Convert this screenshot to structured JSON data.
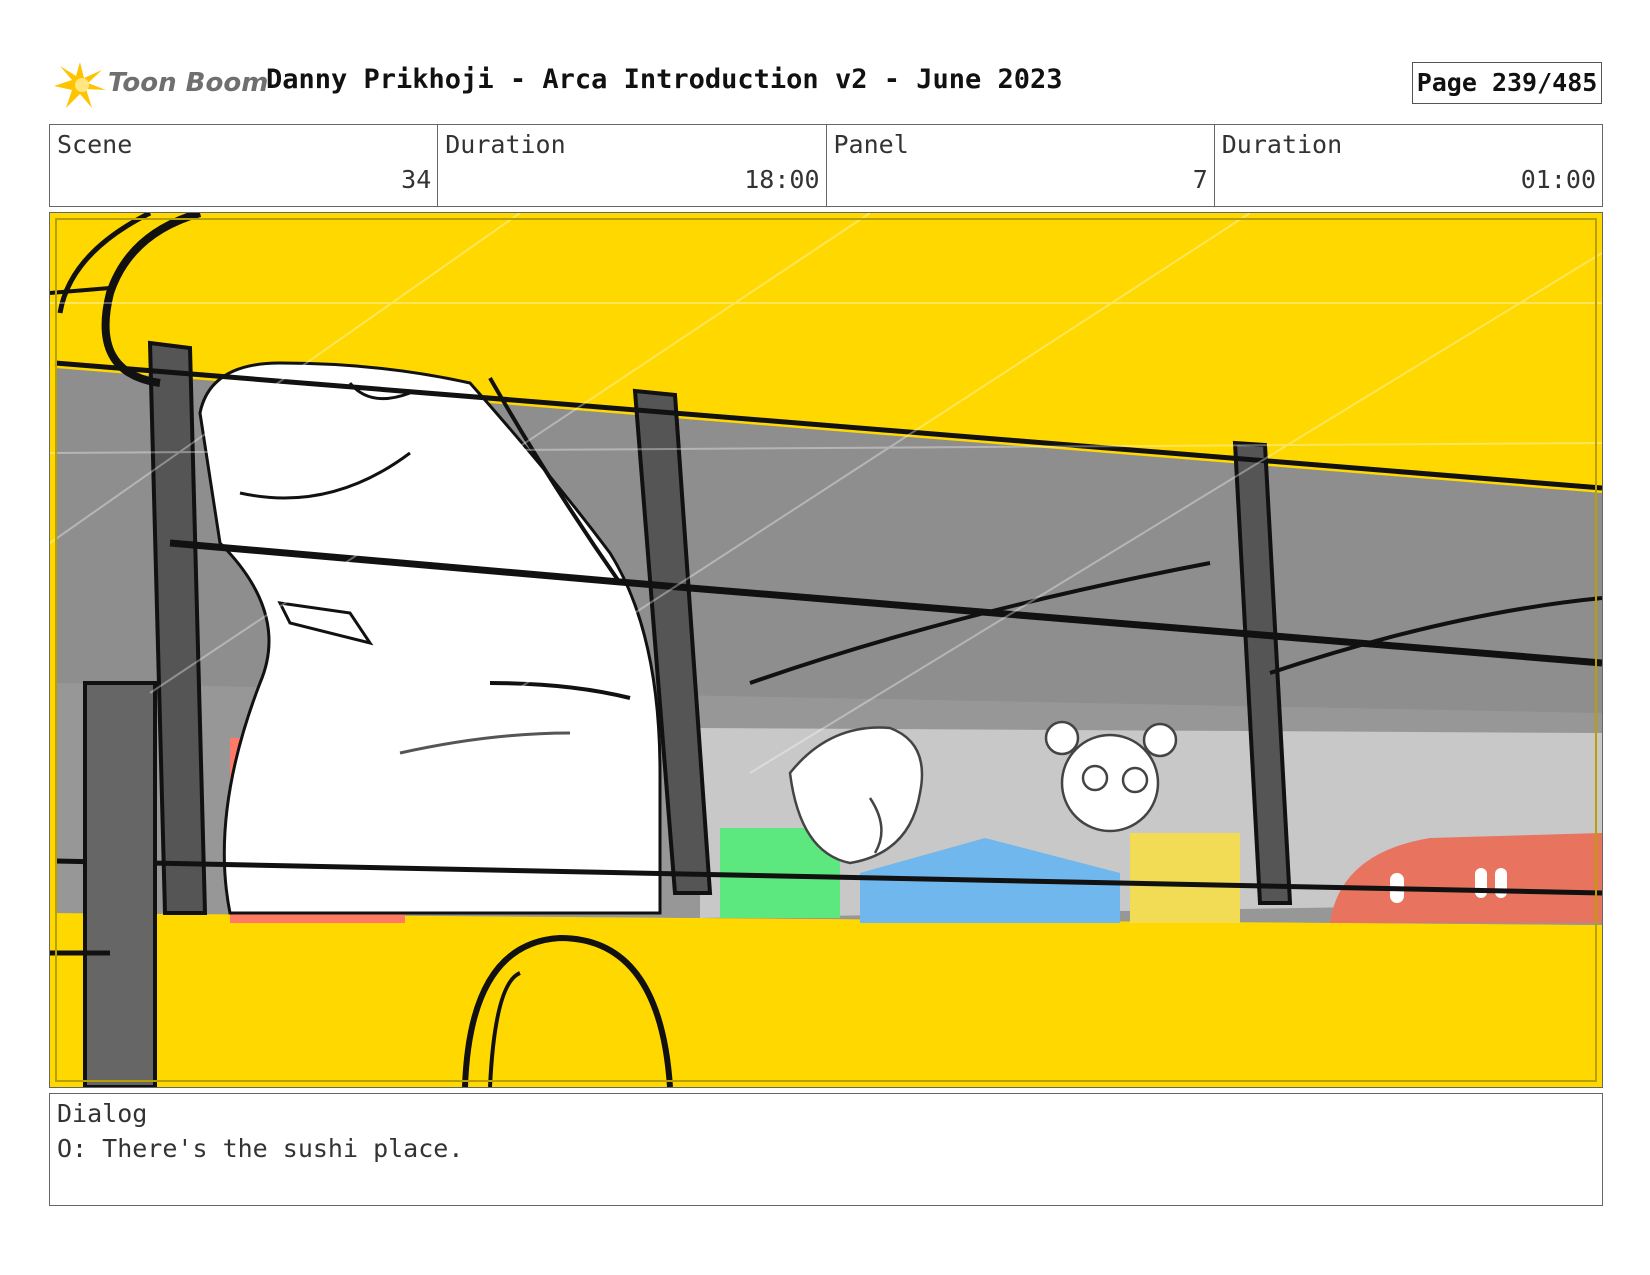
{
  "header": {
    "logo_text": "Toon Boom",
    "title": "Danny Prikhoji - Arca Introduction v2 - June 2023",
    "page": "Page 239/485"
  },
  "info": {
    "scene_label": "Scene",
    "scene_value": "34",
    "scene_duration_label": "Duration",
    "scene_duration_value": "18:00",
    "panel_label": "Panel",
    "panel_value": "7",
    "panel_duration_label": "Duration",
    "panel_duration_value": "01:00"
  },
  "dialog": {
    "label": "Dialog",
    "text": "O: There's the sushi place."
  },
  "colors": {
    "bus_yellow": "#ffd800",
    "window_gray": "#8e8e8e",
    "line_black": "#111111",
    "building_red": "#ff7a66",
    "building_green": "#5de87f",
    "building_blue": "#7fc6f3",
    "building_yellow": "#f3dc55"
  }
}
